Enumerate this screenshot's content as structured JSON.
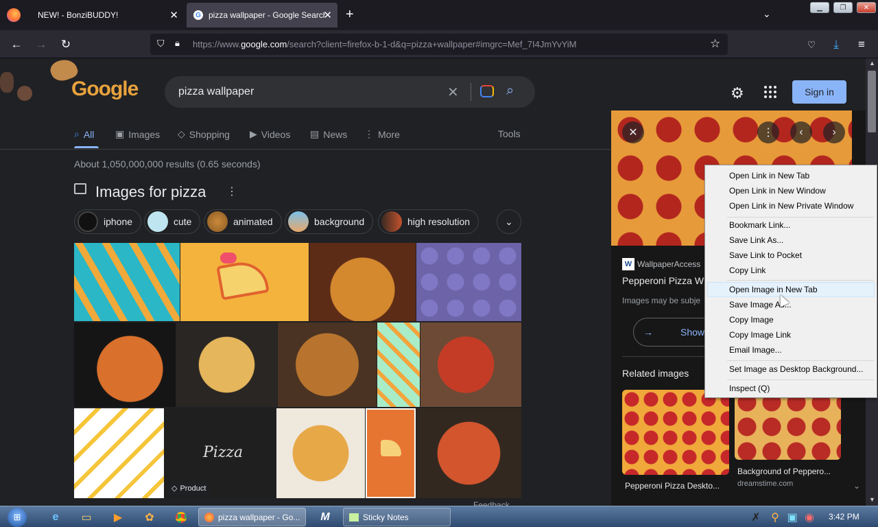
{
  "browser": {
    "tabs": [
      {
        "title": "NEW! - BonziBUDDY!"
      },
      {
        "title": "pizza wallpaper - Google Search"
      }
    ],
    "url_host_prefix": "https://www.",
    "url_host": "google.com",
    "url_rest": "/search?client=firefox-b-1-d&q=pizza+wallpaper#imgrc=Mef_7I4JmYvYiM"
  },
  "google": {
    "logo": "Google",
    "query": "pizza wallpaper",
    "sign_in": "Sign in",
    "nav_tabs": [
      "All",
      "Images",
      "Shopping",
      "Videos",
      "News",
      "More"
    ],
    "tools": "Tools",
    "stats": "About 1,050,000,000 results (0.65 seconds)",
    "images_heading": "Images for pizza",
    "chips": [
      "iphone",
      "cute",
      "animated",
      "background",
      "high resolution"
    ],
    "product_badge": "Product",
    "feedback": "Feedback"
  },
  "panel": {
    "source": "WallpaperAccess",
    "title": "Pepperoni Pizza W",
    "note": "Images may be subje",
    "visit_label": "Show",
    "related_heading": "Related images",
    "related": [
      {
        "caption": "Pepperoni Pizza Deskto...",
        "sub": ""
      },
      {
        "caption": "Background of Peppero...",
        "sub": "dreamstime.com"
      }
    ]
  },
  "context_menu": {
    "items": [
      "Open Link in New Tab",
      "Open Link in New Window",
      "Open Link in New Private Window",
      "Bookmark Link...",
      "Save Link As...",
      "Save Link to Pocket",
      "Copy Link",
      "Open Image in New Tab",
      "Save Image As...",
      "Copy Image",
      "Copy Image Link",
      "Email Image...",
      "Set Image as Desktop Background...",
      "Inspect (Q)"
    ],
    "highlighted": "Open Image in New Tab"
  },
  "taskbar": {
    "buttons": [
      "pizza wallpaper - Go...",
      "Sticky Notes"
    ],
    "clock": "3:42 PM"
  },
  "colors": {
    "accent": "#8ab4f8",
    "page_bg": "#202124",
    "pizza_red": "#b3261e",
    "pizza_yellow": "#f3b33d"
  }
}
